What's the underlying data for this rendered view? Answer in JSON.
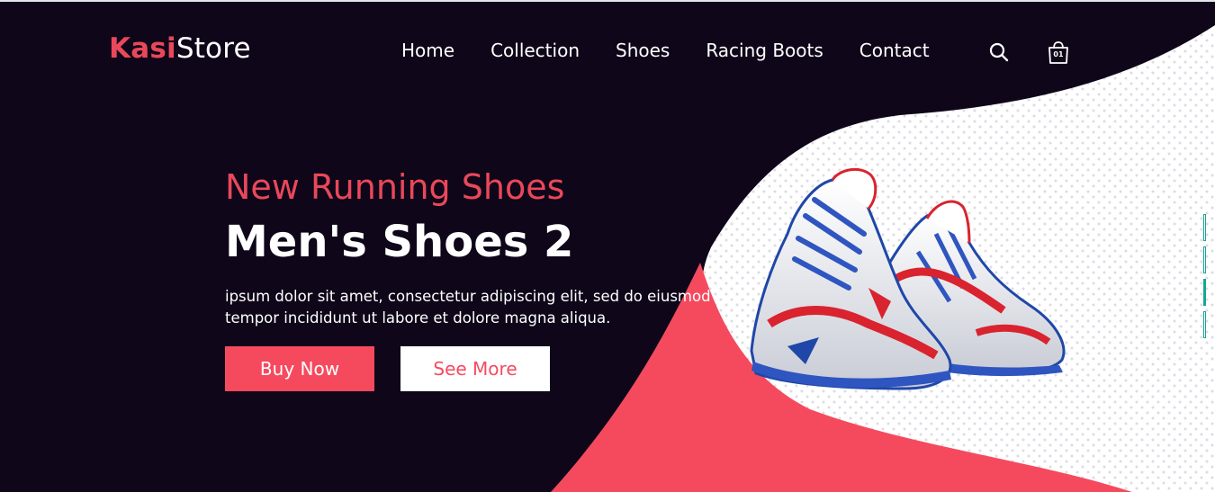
{
  "header": {
    "logo": {
      "accent": "Kasi",
      "rest": "Store"
    },
    "nav": [
      "Home",
      "Collection",
      "Shoes",
      "Racing Boots",
      "Contact"
    ],
    "search_icon": "search-icon",
    "cart": {
      "icon": "shopping-bag-icon",
      "count": "01"
    }
  },
  "hero": {
    "subtitle": "New Running Shoes",
    "title": "Men's Shoes 2",
    "description": "ipsum dolor sit amet, consectetur adipiscing elit, sed do eiusmod tempor incididunt ut labore et dolore magna aliqua.",
    "buttons": {
      "primary": "Buy Now",
      "secondary": "See More"
    },
    "image": "running-shoes-image"
  },
  "slider": {
    "slides": 4,
    "active": 3
  },
  "colors": {
    "background": "#0f0619",
    "accent": "#e9485a",
    "button": "#f54a5e",
    "indicator": "#16a596",
    "pattern_bg": "#ffffff",
    "pattern_dot": "#dcdce4"
  }
}
